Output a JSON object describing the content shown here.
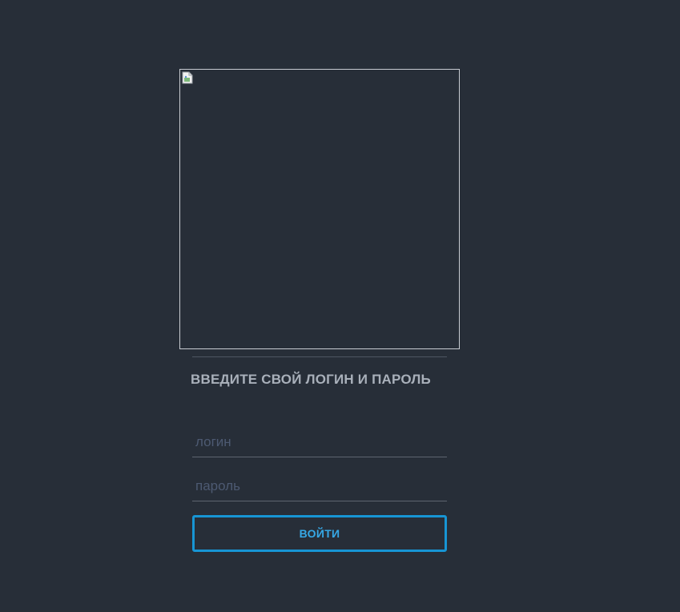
{
  "logo": {
    "icon": "broken-image-icon"
  },
  "form": {
    "heading": "ВВЕДИТЕ СВОЙ ЛОГИН И ПАРОЛЬ",
    "login_placeholder": "логин",
    "login_value": "",
    "password_placeholder": "пароль",
    "password_value": "",
    "submit_label": "ВОЙТИ"
  },
  "colors": {
    "background": "#272e38",
    "accent": "#1795d4",
    "heading_text": "#a9b0ba",
    "placeholder": "#4d5a72"
  }
}
